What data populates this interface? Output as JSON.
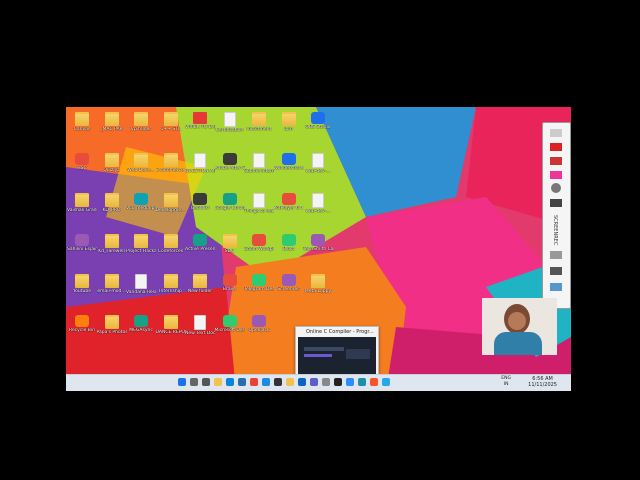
{
  "desktop": {
    "icons": [
      {
        "label": "Canvas",
        "kind": "folder"
      },
      {
        "label": "_MAC PAR",
        "kind": "folder"
      },
      {
        "label": "Vp folder",
        "kind": "folder"
      },
      {
        "label": "C++ STL",
        "kind": "folder"
      },
      {
        "label": "VIVIEK TO EXPORTS",
        "kind": "pdf"
      },
      {
        "label": "Certification",
        "kind": "file"
      },
      {
        "label": "Instiftment",
        "kind": "folder"
      },
      {
        "label": "Ibm",
        "kind": "folder"
      },
      {
        "label": "OBS Studio",
        "kind": "app"
      },
      {
        "label": "HSC",
        "kind": "app"
      },
      {
        "label": "Quizlyz",
        "kind": "folder"
      },
      {
        "label": "Web Deve...",
        "kind": "folder"
      },
      {
        "label": "E-commerce Hackathon",
        "kind": "folder"
      },
      {
        "label": "QUESTION A(INTEGR...",
        "kind": "file"
      },
      {
        "label": "Adobe After Effects 2020",
        "kind": "app"
      },
      {
        "label": "Submit Internshi...",
        "kind": "file"
      },
      {
        "label": "Wondershare Filmora 10",
        "kind": "app"
      },
      {
        "label": "web-dev-...",
        "kind": "file"
      },
      {
        "label": "Vaishali Grads",
        "kind": "folder"
      },
      {
        "label": "KD_PRO",
        "kind": "folder"
      },
      {
        "label": "VLC media player",
        "kind": "app"
      },
      {
        "label": "Developme...",
        "kind": "folder"
      },
      {
        "label": "GeoWiki",
        "kind": "app"
      },
      {
        "label": "Google Chrome",
        "kind": "app"
      },
      {
        "label": "Things to learn",
        "kind": "file"
      },
      {
        "label": "PotPlayer 64 bit",
        "kind": "app"
      },
      {
        "label": "web-dev-...",
        "kind": "file"
      },
      {
        "label": "Sahilini Esjain",
        "kind": "app"
      },
      {
        "label": "Kd_Farewell",
        "kind": "folder"
      },
      {
        "label": "Project Hackathon",
        "kind": "folder"
      },
      {
        "label": "Codeforces",
        "kind": "folder"
      },
      {
        "label": "Active Presenter",
        "kind": "app"
      },
      {
        "label": "SDC",
        "kind": "folder"
      },
      {
        "label": "Zoom Workplace",
        "kind": "app"
      },
      {
        "label": "Blust",
        "kind": "app"
      },
      {
        "label": "TechSmith Capture",
        "kind": "app"
      },
      {
        "label": "Youtube",
        "kind": "folder"
      },
      {
        "label": "email-mod...",
        "kind": "folder"
      },
      {
        "label": "Vandana Resume.docx",
        "kind": "file"
      },
      {
        "label": "Internship",
        "kind": "folder"
      },
      {
        "label": "New folder",
        "kind": "folder"
      },
      {
        "label": "Brave",
        "kind": "app"
      },
      {
        "label": "Telegram Desktop",
        "kind": "app"
      },
      {
        "label": "Screenrec",
        "kind": "app"
      },
      {
        "label": "Meta Lappy",
        "kind": "folder"
      },
      {
        "label": "Recycle Bin",
        "kind": "app"
      },
      {
        "label": "Papa's Photos",
        "kind": "folder"
      },
      {
        "label": "MEGAsync",
        "kind": "app"
      },
      {
        "label": "DANCE REPORT",
        "kind": "folder"
      },
      {
        "label": "New Text Document",
        "kind": "file"
      },
      {
        "label": "Microsoft Desktop",
        "kind": "app"
      },
      {
        "label": "Openjack",
        "kind": "app"
      }
    ]
  },
  "taskbar_preview": {
    "title": "Online C Compiler - Progr..."
  },
  "tray": {
    "lang1": "ENG",
    "lang2": "IN",
    "time": "6:56 AM",
    "date": "11/11/2025"
  },
  "recorder": {
    "label": "SCREENREC"
  },
  "colors": {
    "taskbar": "#dfe6ef",
    "folder": "#f0c24b",
    "start": "#1a73e8"
  }
}
